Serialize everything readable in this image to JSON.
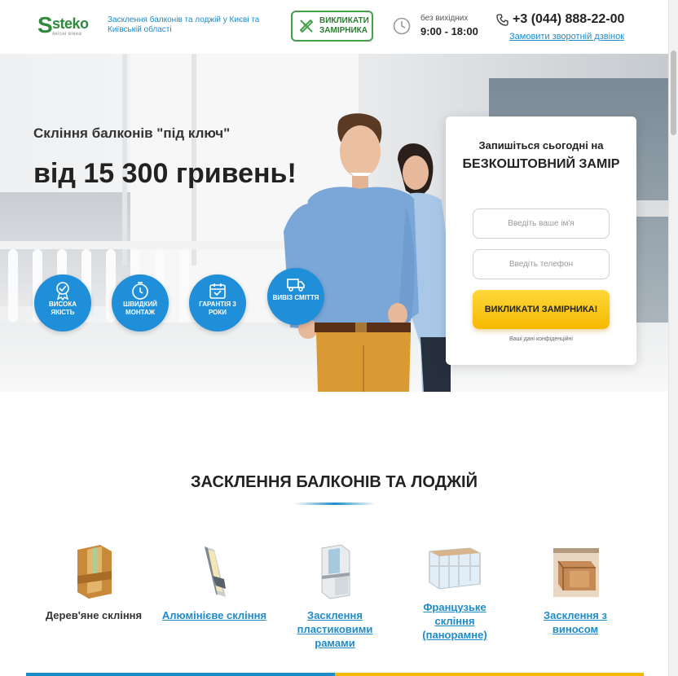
{
  "header": {
    "logo": {
      "letter": "S",
      "word": "steko",
      "sub": "якісні вікна"
    },
    "tagline": "Засклення балконів та лоджій у Києві та Київській області",
    "call_button": "ВИКЛИКАТИ ЗАМІРНИКА",
    "hours_label": "без вихідних",
    "hours": "9:00 - 18:00",
    "phone": "+3 (044) 888-22-00",
    "callback_link": "Замовити зворотній дзвінок"
  },
  "hero": {
    "subtitle": "Скління балконів \"під ключ\"",
    "price": "від 15 300 гривень!",
    "badges": [
      {
        "icon": "medal-icon",
        "label": "ВИСОКА ЯКІСТЬ"
      },
      {
        "icon": "clock-icon",
        "label": "ШВИДКИЙ МОНТАЖ"
      },
      {
        "icon": "calendar-icon",
        "label": "ГАРАНТІЯ 3 РОКИ"
      },
      {
        "icon": "truck-icon",
        "label": "ВИВІЗ СМІТТЯ"
      }
    ]
  },
  "form": {
    "line1": "Запишіться сьогодні на",
    "line2": "БЕЗКОШТОВНИЙ ЗАМІР",
    "name_placeholder": "Введіть ваше ім'я",
    "phone_placeholder": "Введіть телефон",
    "submit": "ВИКЛИКАТИ ЗАМІРНИКА!",
    "privacy": "Ваші дані конфіденційні"
  },
  "section": {
    "title": "ЗАСКЛЕННЯ БАЛКОНІВ ТА ЛОДЖІЙ",
    "products": [
      {
        "label": "Дерев'яне скління",
        "link": false,
        "icon": "wooden-profile-icon"
      },
      {
        "label": "Алюмінієве скління",
        "link": true,
        "icon": "aluminium-profile-icon"
      },
      {
        "label": "Засклення пластиковими рамами",
        "link": true,
        "icon": "plastic-profile-icon"
      },
      {
        "label": "Французьке скління (панорамне)",
        "link": true,
        "icon": "panoramic-balcony-icon"
      },
      {
        "label": "Засклення з виносом",
        "link": true,
        "icon": "extended-balcony-icon"
      }
    ]
  },
  "colors": {
    "brand_green": "#2f8a3b",
    "accent_blue": "#1e8bc9",
    "cta_yellow": "#f5b800"
  }
}
